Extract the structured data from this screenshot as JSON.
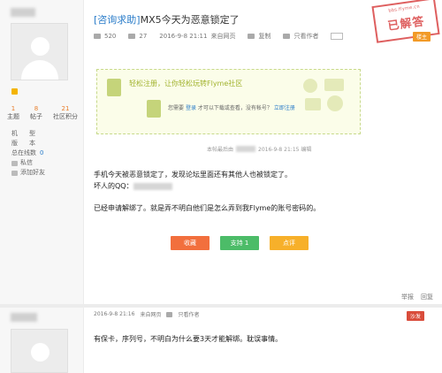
{
  "post": {
    "tag": "[咨询求助]",
    "title": "MX5今天为恶意锁定了",
    "views": "520",
    "replies": "27",
    "date": "2016-9-8 21:11",
    "device": "来自网页",
    "favorite_label": "复制",
    "author_only": "只看作者",
    "floor_tag": "楼主",
    "stamp_url": "bbs.flyme.cn",
    "stamp_text": "已解答"
  },
  "login_box": {
    "headline": "轻松注册，让你轻松玩转Flyme社区",
    "prefix": "您需要",
    "login_link": "登录",
    "suffix": "才可以下载或查看，没有帐号？",
    "register_link": "立即注册"
  },
  "edit_note": {
    "prefix": "本帖最后由",
    "suffix": "2016-9-8 21:15 编辑"
  },
  "content": {
    "line1": "手机今天被恶意锁定了，发现论坛里面还有其他人也被锁定了。",
    "line2": "坏人的QQ：",
    "line3": "已经申请解绑了。就是弄不明白他们是怎么弄到我Flyme的账号密码的。"
  },
  "buttons": {
    "favorite": "收藏",
    "support": "支持 1",
    "rate": "点评"
  },
  "post_links": {
    "report": "举报",
    "reply": "回复"
  },
  "user": {
    "stats": [
      {
        "num": "1",
        "label": "主题"
      },
      {
        "num": "8",
        "label": "帖子"
      },
      {
        "num": "21",
        "label": "社区积分"
      }
    ],
    "profile": [
      {
        "k": "机",
        "v": "型"
      },
      {
        "k": "版",
        "v": "本"
      }
    ],
    "online_label": "总在线数",
    "online_value": "0",
    "message_label": "私信",
    "add_friend_label": "添加好友"
  },
  "reply_post": {
    "date": "2016-9-8 21:16",
    "device": "来自网页",
    "author_only": "只看作者",
    "floor_tag": "沙发",
    "text": "有保卡，序列号，不明白为什么要3天才能解绑。耽误事情。"
  },
  "colors": {
    "link": "#2a7cc9",
    "stamp": "#d94444",
    "fav_btn": "#f26f3d",
    "support_btn": "#4cbc68",
    "rate_btn": "#f7b02a"
  }
}
